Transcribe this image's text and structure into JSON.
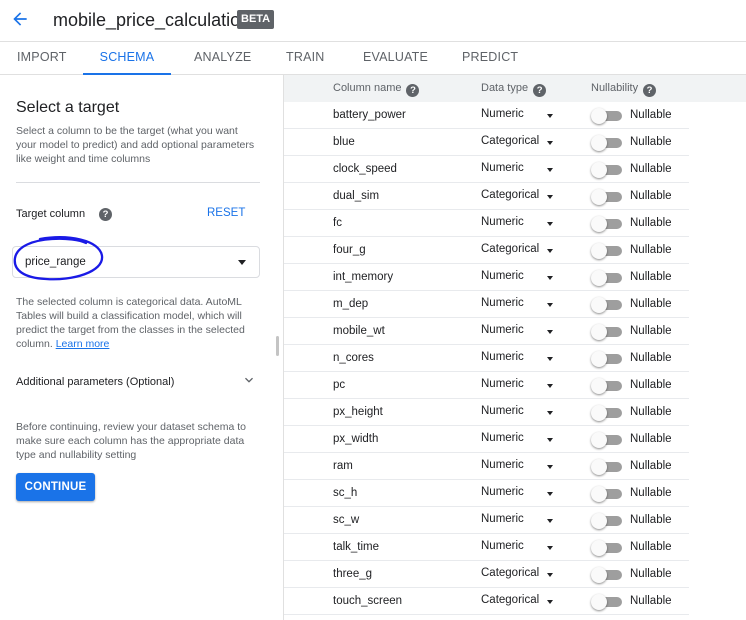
{
  "header": {
    "title": "mobile_price_calculation",
    "badge": "BETA",
    "back_icon": "arrow-back-icon"
  },
  "tabs": [
    {
      "label": "IMPORT",
      "active": false
    },
    {
      "label": "SCHEMA",
      "active": true
    },
    {
      "label": "ANALYZE",
      "active": false
    },
    {
      "label": "TRAIN",
      "active": false
    },
    {
      "label": "EVALUATE",
      "active": false
    },
    {
      "label": "PREDICT",
      "active": false
    }
  ],
  "left_panel": {
    "title": "Select a target",
    "description": "Select a column to be the target (what you want your model to predict) and add optional parameters like weight and time columns",
    "target_label": "Target column",
    "reset_label": "RESET",
    "target_value": "price_range",
    "target_info": "The selected column is categorical data. AutoML Tables will build a classification model, which will predict the target from the classes in the selected column.",
    "learn_more": "Learn more",
    "additional_params": "Additional parameters (Optional)",
    "review_text": "Before continuing, review your dataset schema to make sure each column has the appropriate data type and nullability setting",
    "continue_label": "CONTINUE"
  },
  "table": {
    "headers": {
      "name": "Column name",
      "type": "Data type",
      "nullability": "Nullability"
    },
    "rows": [
      {
        "name": "battery_power",
        "type": "Numeric",
        "nullable": "Nullable"
      },
      {
        "name": "blue",
        "type": "Categorical",
        "nullable": "Nullable"
      },
      {
        "name": "clock_speed",
        "type": "Numeric",
        "nullable": "Nullable"
      },
      {
        "name": "dual_sim",
        "type": "Categorical",
        "nullable": "Nullable"
      },
      {
        "name": "fc",
        "type": "Numeric",
        "nullable": "Nullable"
      },
      {
        "name": "four_g",
        "type": "Categorical",
        "nullable": "Nullable"
      },
      {
        "name": "int_memory",
        "type": "Numeric",
        "nullable": "Nullable"
      },
      {
        "name": "m_dep",
        "type": "Numeric",
        "nullable": "Nullable"
      },
      {
        "name": "mobile_wt",
        "type": "Numeric",
        "nullable": "Nullable"
      },
      {
        "name": "n_cores",
        "type": "Numeric",
        "nullable": "Nullable"
      },
      {
        "name": "pc",
        "type": "Numeric",
        "nullable": "Nullable"
      },
      {
        "name": "px_height",
        "type": "Numeric",
        "nullable": "Nullable"
      },
      {
        "name": "px_width",
        "type": "Numeric",
        "nullable": "Nullable"
      },
      {
        "name": "ram",
        "type": "Numeric",
        "nullable": "Nullable"
      },
      {
        "name": "sc_h",
        "type": "Numeric",
        "nullable": "Nullable"
      },
      {
        "name": "sc_w",
        "type": "Numeric",
        "nullable": "Nullable"
      },
      {
        "name": "talk_time",
        "type": "Numeric",
        "nullable": "Nullable"
      },
      {
        "name": "three_g",
        "type": "Categorical",
        "nullable": "Nullable"
      },
      {
        "name": "touch_screen",
        "type": "Categorical",
        "nullable": "Nullable"
      }
    ]
  },
  "colors": {
    "accent": "#1a73e8",
    "badge": "#5f6368",
    "annotation": "#1a1ae6"
  }
}
